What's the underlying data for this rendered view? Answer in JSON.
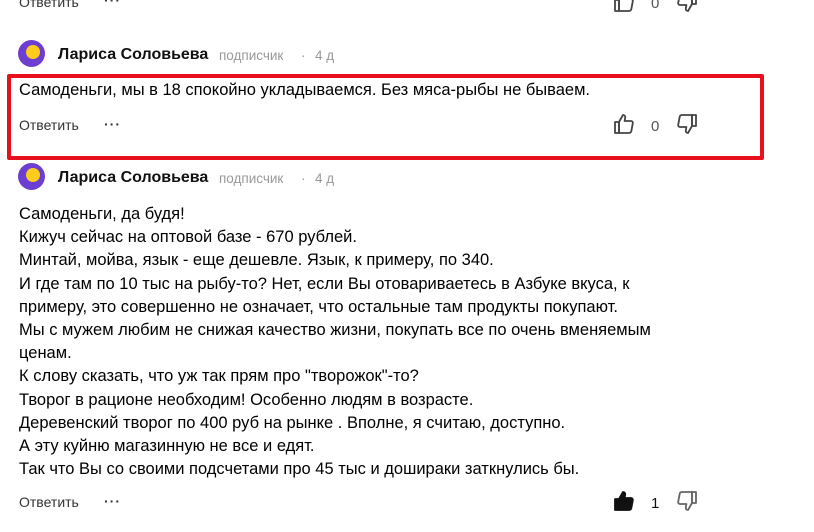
{
  "top_actions": {
    "reply_label": "Ответить",
    "likes": "0"
  },
  "comments": [
    {
      "author": "Лариса Соловьева",
      "role": "подписчик",
      "separator": "·",
      "time": "4 д",
      "text": "Самоденьги, мы в 18 спокойно укладываемся. Без мяса-рыбы не бываем.",
      "reply_label": "Ответить",
      "more": "···",
      "likes": "0"
    },
    {
      "author": "Лариса Соловьева",
      "role": "подписчик",
      "separator": "·",
      "time": "4 д",
      "lines": [
        "Самоденьги, да будя!",
        "Кижуч сейчас на оптовой базе - 670 рублей.",
        "Минтай, мойва, язык - еще дешевле. Язык, к примеру, по 340.",
        "И где там по 10 тыс на рыбу-то? Нет, если Вы отовариваетесь в Азбуке вкуса, к",
        "примеру, это совершенно не означает, что остальные там продукты покупают.",
        "Мы с мужем любим не снижая качество жизни, покупать все по очень вменяемым",
        "ценам.",
        "К слову сказать, что уж так прям про \"творожок\"-то?",
        "Творог в рационе необходим! Особенно людям в возрасте.",
        "Деревенский творог по 400 руб на рынке . Вполне, я считаю, доступно.",
        "А эту куйню магазинную не все и едят.",
        "Так что Вы со своими подсчетами про 45 тыс и дошираки заткнулись бы."
      ],
      "reply_label": "Ответить",
      "more": "···",
      "likes": "1"
    }
  ],
  "colors": {
    "highlight": "#e8101c",
    "avatar_bg": "#6c3fd1",
    "avatar_fg": "#ffcc1d"
  }
}
